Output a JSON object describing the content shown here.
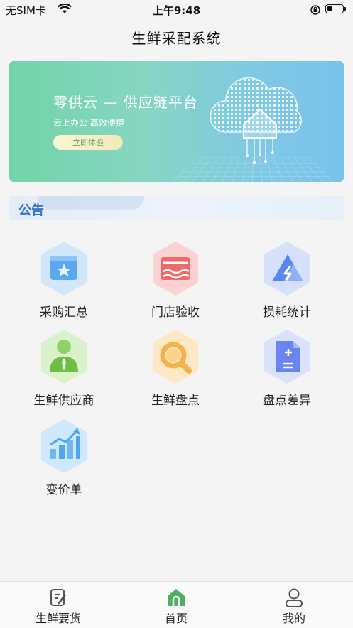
{
  "status_bar": {
    "carrier": "无SIM卡",
    "time": "上午9:48"
  },
  "header": {
    "title": "生鲜采配系统"
  },
  "banner": {
    "headline": "零供云 — 供应链平台",
    "subtitle": "云上办公  高效便捷",
    "button_label": "立即体验"
  },
  "notice": {
    "label": "公告"
  },
  "menu": {
    "items": [
      {
        "label": "采购汇总",
        "icon": "purchase-summary-icon",
        "color": "#5aa9f0"
      },
      {
        "label": "门店验收",
        "icon": "store-acceptance-icon",
        "color": "#f06a6a"
      },
      {
        "label": "损耗统计",
        "icon": "loss-stats-icon",
        "color": "#5a86f0"
      },
      {
        "label": "生鲜供应商",
        "icon": "supplier-icon",
        "color": "#8fd06a"
      },
      {
        "label": "生鲜盘点",
        "icon": "inventory-check-icon",
        "color": "#f4b24a"
      },
      {
        "label": "盘点差异",
        "icon": "inventory-diff-icon",
        "color": "#6a86ee"
      },
      {
        "label": "变价单",
        "icon": "price-change-icon",
        "color": "#4aa6ee"
      }
    ]
  },
  "tabbar": {
    "tabs": [
      {
        "label": "生鲜要货",
        "icon": "order-edit-icon",
        "active": false
      },
      {
        "label": "首页",
        "icon": "home-icon",
        "active": true
      },
      {
        "label": "我的",
        "icon": "user-icon",
        "active": false
      }
    ]
  }
}
